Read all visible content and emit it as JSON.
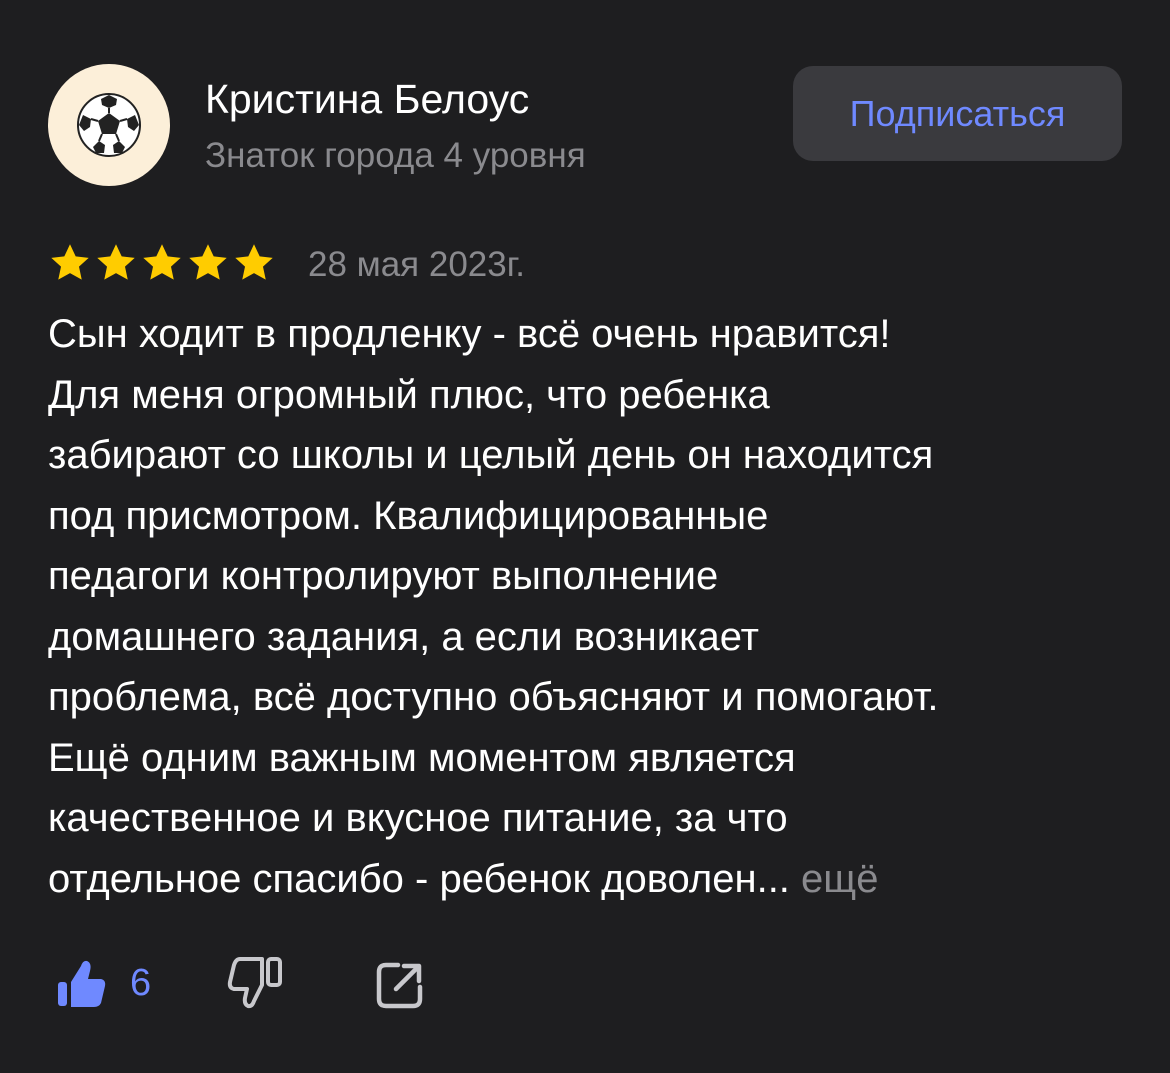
{
  "author": {
    "name": "Кристина Белоус",
    "level": "Знаток города 4 уровня",
    "avatar_icon": "soccer-ball-icon",
    "subscribe_label": "Подписаться"
  },
  "review": {
    "rating": 5,
    "rating_max": 5,
    "date": "28 мая 2023г.",
    "text_lines": [
      "Сын ходит в продленку - всё очень нравится!",
      "Для меня огромный плюс, что ребенка",
      "забирают со школы и целый день он находится",
      "под присмотром. Квалифицированные",
      "педагоги контролируют выполнение",
      "домашнего задания, а если возникает",
      "проблема, всё доступно объясняют и помогают.",
      "Ещё одним важным моментом является",
      "качественное и вкусное питание, за что",
      "отдельное спасибо - ребенок доволен..."
    ],
    "more_label": "ещё"
  },
  "actions": {
    "like_icon": "thumbs-up-icon",
    "like_count": "6",
    "dislike_icon": "thumbs-down-icon",
    "share_icon": "share-icon"
  },
  "colors": {
    "background": "#1e1e20",
    "accent": "#6f89ff",
    "muted_text": "#8a8a8e",
    "star": "#ffcc00",
    "button_bg": "#3a3a3e"
  }
}
